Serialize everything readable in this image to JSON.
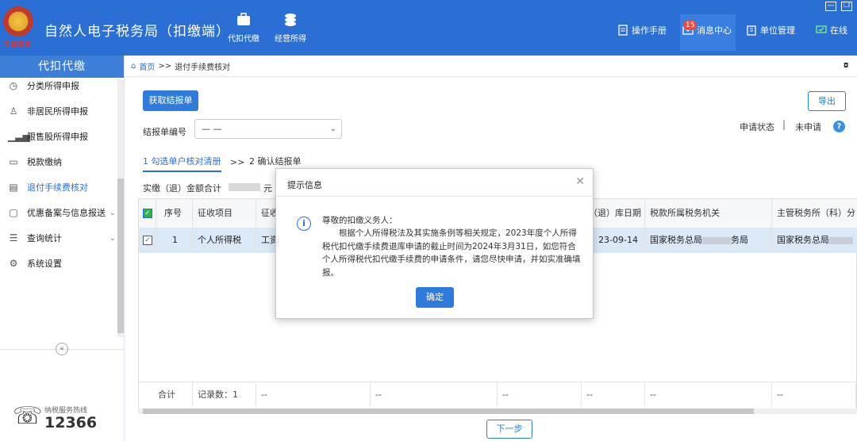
{
  "app": {
    "title": "自然人电子税务局（扣缴端）",
    "emblem_text": "中国税务",
    "nav": [
      {
        "label": "代扣代缴",
        "icon": "briefcase-icon"
      },
      {
        "label": "经营所得",
        "icon": "coins-icon"
      }
    ],
    "tools": {
      "manual": "操作手册",
      "messages": "消息中心",
      "message_count": "15",
      "unit": "单位管理",
      "online": "在线"
    }
  },
  "sidebar": {
    "header": "代扣代缴",
    "items": [
      {
        "label": "分类所得申报",
        "icon": "clock-icon"
      },
      {
        "label": "非居民所得申报",
        "icon": "person-icon"
      },
      {
        "label": "限售股所得申报",
        "icon": "bar-chart-icon"
      },
      {
        "label": "税款缴纳",
        "icon": "wallet-icon"
      },
      {
        "label": "退付手续费核对",
        "icon": "document-icon"
      },
      {
        "label": "优惠备案与信息报送",
        "icon": "file-icon"
      },
      {
        "label": "查询统计",
        "icon": "search-list-icon"
      },
      {
        "label": "系统设置",
        "icon": "gear-icon"
      }
    ],
    "active_index": 4,
    "collapse_symbol": "«",
    "hotline_label": "纳税服务热线",
    "hotline_number": "12366"
  },
  "breadcrumb": {
    "home": "首页",
    "sep": ">>",
    "current": "退付手续费核对"
  },
  "toolbar": {
    "fetch_label": "获取结报单",
    "export_label": "导出",
    "bill_label": "结报单编号",
    "bill_value": "— —",
    "status_label": "申请状态",
    "status_sep": "|",
    "status_value": "未申请",
    "help_symbol": "?"
  },
  "steps": {
    "step1": "1 勾选单户核对清册",
    "sep": ">>",
    "step2": "2 确认结报单"
  },
  "summary": {
    "label": "实缴（退）金额合计",
    "unit": "元"
  },
  "table": {
    "columns": [
      "序号",
      "征收项目",
      "征收",
      "（退）库日期",
      "税款所属税务机关",
      "主管税务所（科）分"
    ],
    "row": {
      "index": "1",
      "item": "个人所得税",
      "sub": "工资",
      "date": "23-09-14",
      "authority_prefix": "国家税务总局",
      "authority_suffix": "务局",
      "office_prefix": "国家税务总局"
    },
    "footer": {
      "total": "合计",
      "count_label": "记录数：1",
      "dash": "--"
    }
  },
  "next_label": "下一步",
  "dialog": {
    "title": "提示信息",
    "greeting": "尊敬的扣缴义务人：",
    "body": "根据个人所得税法及其实施条例等相关规定，2023年度个人所得税代扣代缴手续费退库申请的截止时间为2024年3月31日，如您符合个人所得税代扣代缴手续费的申请条件，请您尽快申请，并如实准确填报。",
    "ok_label": "确定",
    "close_symbol": "✕"
  },
  "colors": {
    "topbar": "#2b6fd4",
    "accent": "#2f7bdb",
    "row_selected": "#dbe8f7",
    "check_green": "#2bb24c"
  }
}
